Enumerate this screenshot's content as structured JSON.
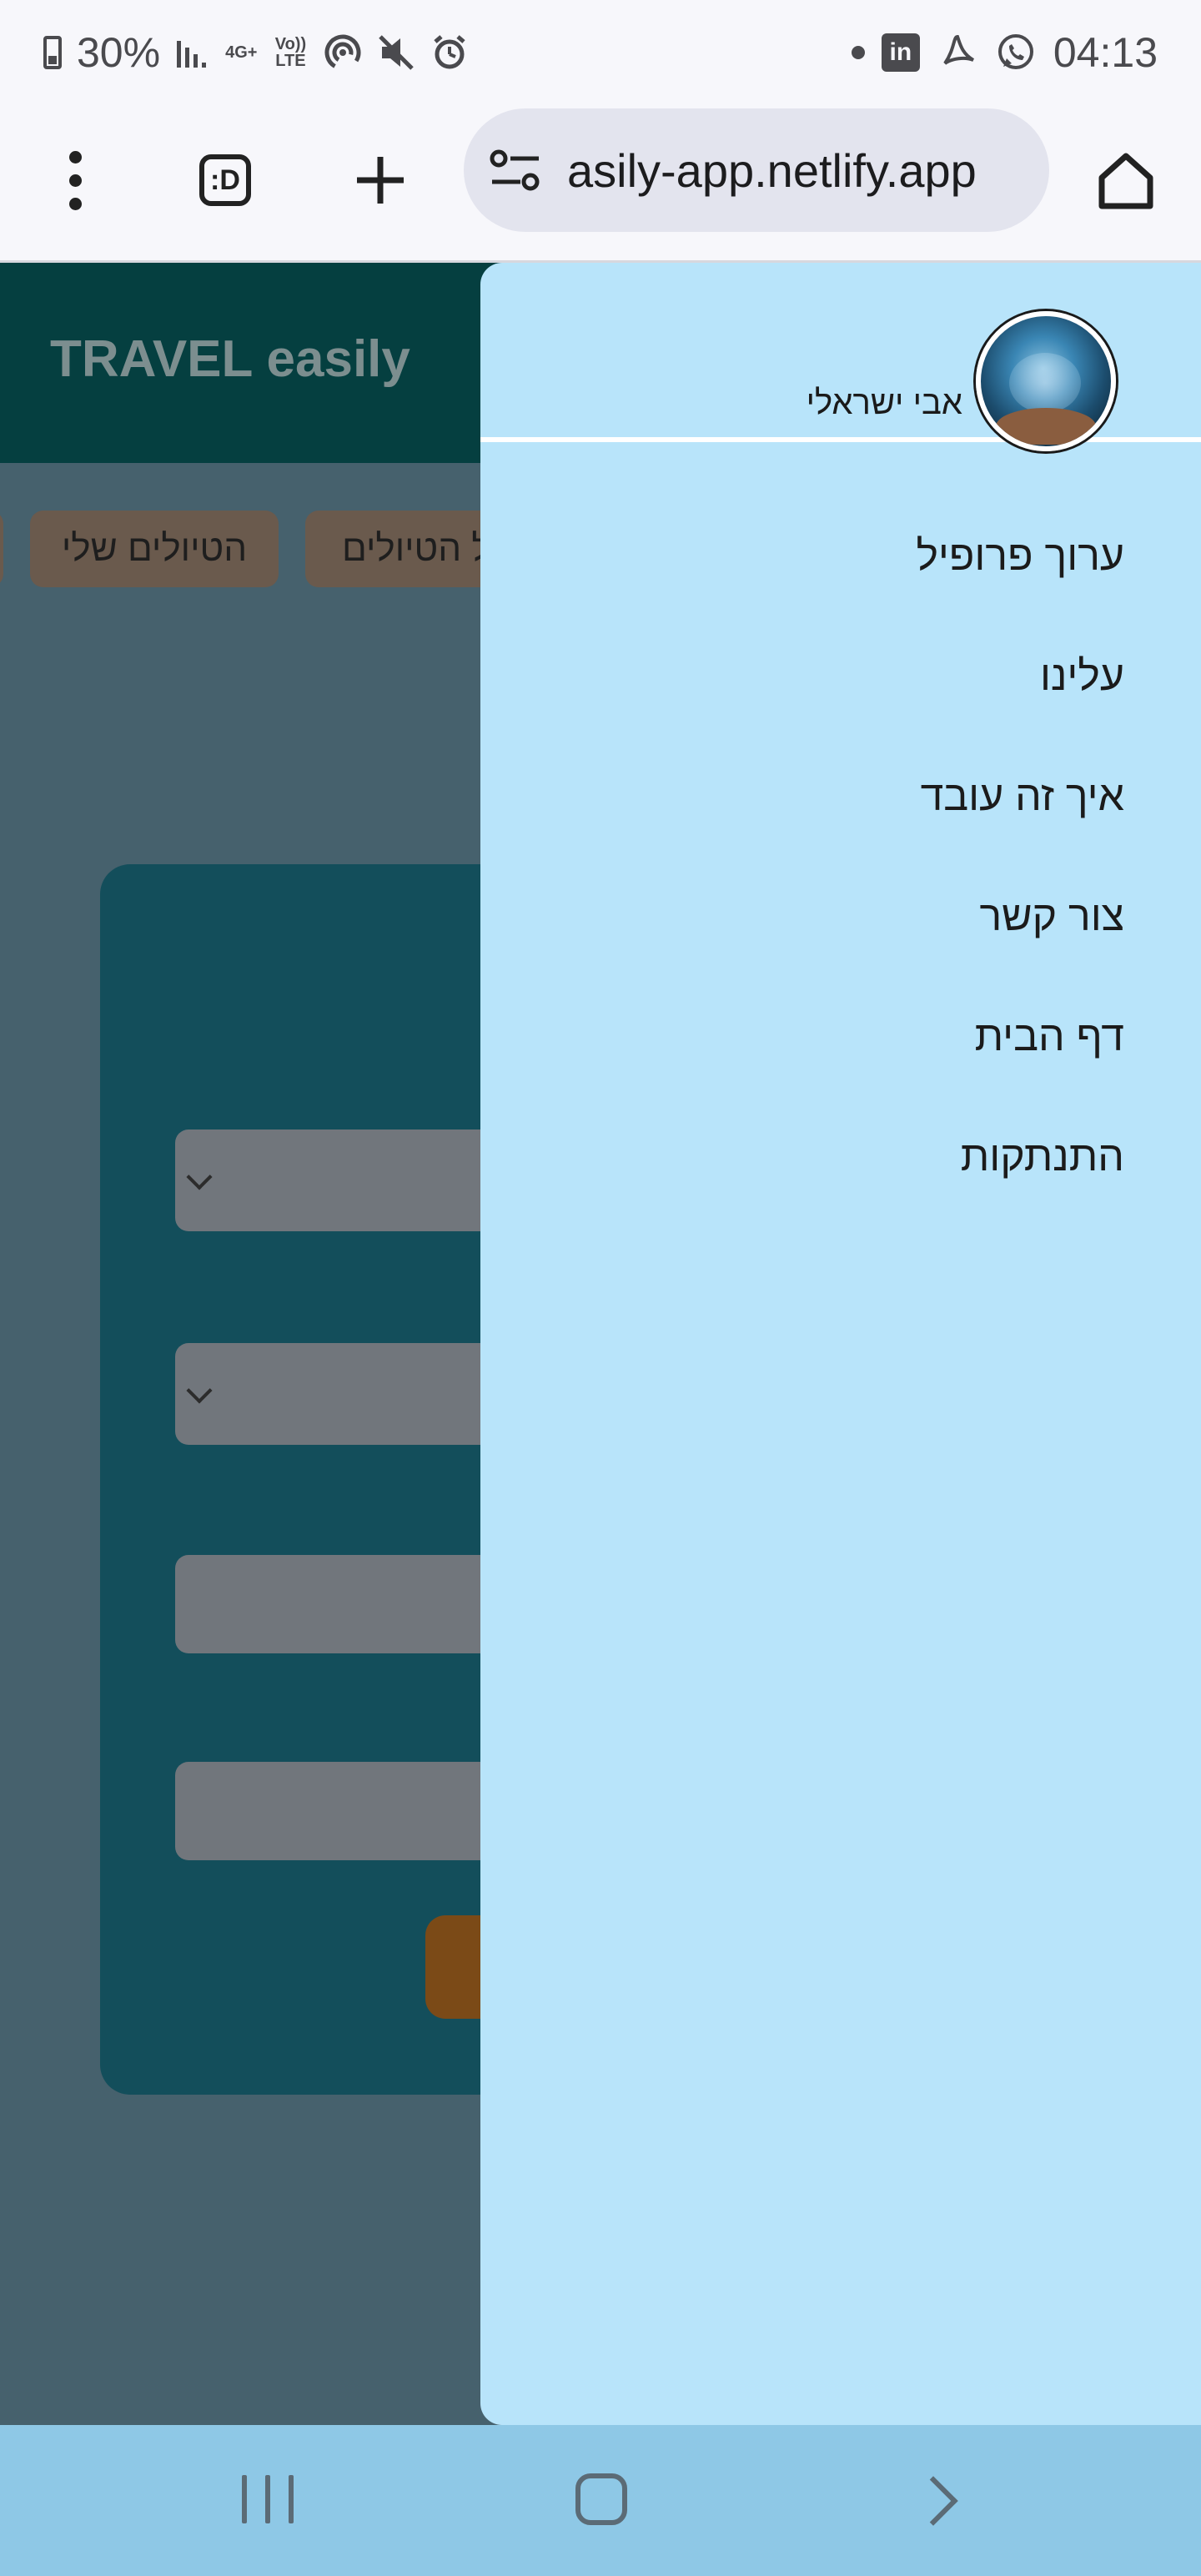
{
  "status_bar": {
    "battery": "30%",
    "network_4g": "4G+",
    "volte": "Vo)) LTE",
    "time": "04:13",
    "icons": [
      "battery-icon",
      "signal-icon",
      "hotspot-icon",
      "mute-icon",
      "alarm-icon",
      "linkedin-icon",
      "acrobat-icon",
      "whatsapp-icon"
    ]
  },
  "browser": {
    "url": "asily-app.netlify.app",
    "tab_label": ":D"
  },
  "app": {
    "title": "TRAVEL easily",
    "chips": [
      "הטיולים שלי",
      "ל הטיולים"
    ]
  },
  "drawer": {
    "user_name": "אבי ישראלי",
    "menu": [
      "ערוך פרופיל",
      "עלינו",
      "איך זה עובד",
      "צור קשר",
      "דף הבית",
      "התנתקות"
    ]
  },
  "colors": {
    "drawer_bg": "#b8e4fa",
    "header_bg": "#053f40",
    "card_bg": "#134e5b",
    "chip_bg": "#6a5a4d",
    "submit_bg": "#7b4a17",
    "navbar_bg": "#8ec8e6"
  }
}
